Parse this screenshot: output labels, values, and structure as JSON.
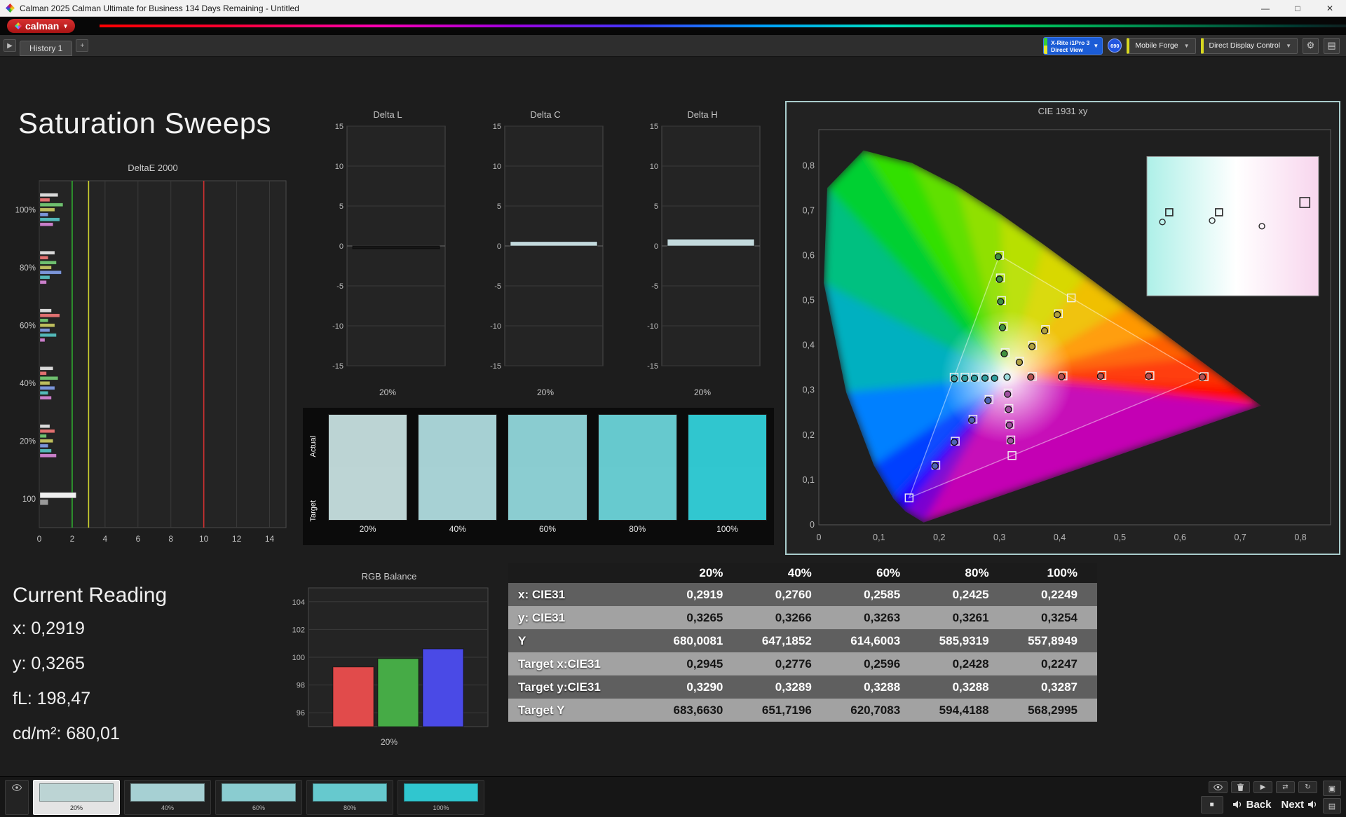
{
  "titlebar": {
    "title": "Calman 2025 Calman Ultimate for Business 134 Days Remaining  - Untitled",
    "minimize": "—",
    "maximize": "□",
    "close": "✕"
  },
  "logobar": {
    "brand": "calman",
    "dropdown": "▾"
  },
  "toolbar": {
    "expand": "▶",
    "history_tab": "History 1",
    "add_tab": "+",
    "meter_button": {
      "line1": "X-Rite i1Pro 3",
      "line2": "Direct View",
      "dropdown": "▼"
    },
    "badge": "690",
    "source_button": {
      "label": "Mobile Forge",
      "dropdown": "▼"
    },
    "control_button": {
      "label": "Direct Display Control",
      "dropdown": "▼"
    },
    "gear": "⚙",
    "panel": "▤"
  },
  "page_title": "Saturation Sweeps",
  "current_reading": {
    "title": "Current Reading",
    "lines": [
      "x: 0,2919",
      "y: 0,3265",
      "fL: 198,47",
      "cd/m²: 680,01"
    ]
  },
  "charts": {
    "deltae": {
      "type": "bar",
      "title": "DeltaE 2000",
      "x_ticks": [
        0,
        2,
        4,
        6,
        8,
        10,
        12,
        14
      ],
      "xmax": 15,
      "ref_lines": [
        {
          "value": 2,
          "color": "#2fae2f"
        },
        {
          "value": 3,
          "color": "#cdd230"
        },
        {
          "value": 10,
          "color": "#d03030"
        }
      ],
      "bar_palette": [
        "#d9d9d9",
        "#e07070",
        "#6fbf6f",
        "#bdbd5e",
        "#7b95d8",
        "#54b8b8",
        "#c97fc9"
      ],
      "groups": [
        {
          "label": "100%",
          "bars": [
            1.1,
            0.6,
            1.4,
            0.9,
            0.5,
            1.2,
            0.8
          ]
        },
        {
          "label": "80%",
          "bars": [
            0.9,
            0.5,
            1.0,
            0.7,
            1.3,
            0.6,
            0.4
          ]
        },
        {
          "label": "60%",
          "bars": [
            0.7,
            1.2,
            0.5,
            0.9,
            0.6,
            1.0,
            0.3
          ]
        },
        {
          "label": "40%",
          "bars": [
            0.8,
            0.4,
            1.1,
            0.6,
            0.9,
            0.5,
            0.7
          ]
        },
        {
          "label": "20%",
          "bars": [
            0.6,
            0.9,
            0.4,
            0.8,
            0.5,
            0.7,
            1.0
          ]
        },
        {
          "label": "100",
          "bars": [
            2.2,
            0.5
          ],
          "palette": [
            "#efefef",
            "#9a9a9a"
          ]
        }
      ]
    },
    "delta_l": {
      "type": "bar",
      "title": "Delta L",
      "xlabel": "20%",
      "value": -0.35,
      "color": "#161616",
      "ymin": -15,
      "ymax": 15
    },
    "delta_c": {
      "type": "bar",
      "title": "Delta C",
      "xlabel": "20%",
      "value": 0.55,
      "color": "#c3dadd",
      "ymin": -15,
      "ymax": 15
    },
    "delta_h": {
      "type": "bar",
      "title": "Delta H",
      "xlabel": "20%",
      "value": 0.85,
      "color": "#c3dadd",
      "ymin": -15,
      "ymax": 15
    },
    "rgb": {
      "type": "bar",
      "title": "RGB Balance",
      "xlabel": "20%",
      "ymin": 95,
      "ymax": 105,
      "y_ticks": [
        96,
        98,
        100,
        102,
        104
      ],
      "bars": [
        {
          "name": "red",
          "value": 99.3,
          "color": "#e14b4b"
        },
        {
          "name": "green",
          "value": 99.9,
          "color": "#46ab46"
        },
        {
          "name": "blue",
          "value": 100.6,
          "color": "#4a4ae6"
        }
      ]
    },
    "cie": {
      "type": "scatter",
      "title": "CIE 1931 xy",
      "x_ticks": [
        "0",
        "0,1",
        "0,2",
        "0,3",
        "0,4",
        "0,5",
        "0,6",
        "0,7",
        "0,8"
      ],
      "y_ticks": [
        "0",
        "0,1",
        "0,2",
        "0,3",
        "0,4",
        "0,5",
        "0,6",
        "0,7",
        "0,8"
      ],
      "white_point": [
        0.3127,
        0.329
      ],
      "gamut_triangle": [
        [
          0.64,
          0.33
        ],
        [
          0.3,
          0.6
        ],
        [
          0.15,
          0.06
        ]
      ],
      "sweeps": [
        {
          "name": "cyan",
          "color": "#2f9f9f",
          "targets": [
            [
              0.2945,
              0.329
            ],
            [
              0.2776,
              0.3289
            ],
            [
              0.2596,
              0.3288
            ],
            [
              0.2428,
              0.3288
            ],
            [
              0.2247,
              0.3287
            ]
          ],
          "measured": [
            [
              0.2919,
              0.3265
            ],
            [
              0.276,
              0.3266
            ],
            [
              0.2585,
              0.3263
            ],
            [
              0.2425,
              0.3261
            ],
            [
              0.2249,
              0.3254
            ]
          ]
        },
        {
          "name": "red",
          "color": "#b45050",
          "targets": [
            [
              0.3547,
              0.3303
            ],
            [
              0.4056,
              0.3316
            ],
            [
              0.4703,
              0.3326
            ],
            [
              0.55,
              0.3322
            ],
            [
              0.64,
              0.33
            ]
          ],
          "measured": [
            [
              0.352,
              0.329
            ],
            [
              0.403,
              0.33
            ],
            [
              0.468,
              0.331
            ],
            [
              0.548,
              0.331
            ],
            [
              0.637,
              0.329
            ]
          ]
        },
        {
          "name": "green",
          "color": "#3f8f3f",
          "targets": [
            [
              0.3096,
              0.3837
            ],
            [
              0.3063,
              0.4419
            ],
            [
              0.3036,
              0.4994
            ],
            [
              0.3016,
              0.5498
            ],
            [
              0.3,
              0.6
            ]
          ],
          "measured": [
            [
              0.308,
              0.381
            ],
            [
              0.305,
              0.439
            ],
            [
              0.302,
              0.497
            ],
            [
              0.3,
              0.547
            ],
            [
              0.298,
              0.597
            ]
          ]
        },
        {
          "name": "blue",
          "color": "#4f64b4",
          "targets": [
            [
              0.2827,
              0.2793
            ],
            [
              0.2561,
              0.2352
            ],
            [
              0.2266,
              0.1862
            ],
            [
              0.1944,
              0.1327
            ],
            [
              0.15,
              0.06
            ]
          ],
          "measured": [
            [
              0.281,
              0.277
            ],
            [
              0.254,
              0.233
            ],
            [
              0.225,
              0.184
            ],
            [
              0.193,
              0.131
            ],
            null
          ]
        },
        {
          "name": "magenta",
          "color": "#a050a0",
          "targets": [
            [
              0.3143,
              0.2936
            ],
            [
              0.3158,
              0.259
            ],
            [
              0.3174,
              0.2238
            ],
            [
              0.319,
              0.189
            ],
            [
              0.3209,
              0.1542
            ]
          ],
          "measured": [
            [
              0.3135,
              0.291
            ],
            [
              0.315,
              0.257
            ],
            [
              0.3165,
              0.222
            ],
            [
              0.3185,
              0.187
            ],
            null
          ]
        },
        {
          "name": "yellow",
          "color": "#b0a040",
          "targets": [
            [
              0.3338,
              0.3642
            ],
            [
              0.3551,
              0.3994
            ],
            [
              0.3766,
              0.4349
            ],
            [
              0.398,
              0.4701
            ],
            [
              0.4193,
              0.5053
            ]
          ],
          "measured": [
            [
              0.333,
              0.362
            ],
            [
              0.354,
              0.397
            ],
            [
              0.375,
              0.432
            ],
            [
              0.396,
              0.468
            ],
            null
          ]
        }
      ],
      "inset": {
        "squares": [
          [
            0.13,
            0.4
          ],
          [
            0.42,
            0.4
          ],
          [
            0.92,
            0.33
          ]
        ],
        "circles": [
          [
            0.09,
            0.47
          ],
          [
            0.38,
            0.46
          ],
          [
            0.67,
            0.5
          ]
        ]
      }
    }
  },
  "swatch_strip": {
    "row_labels": [
      "Actual",
      "Target"
    ],
    "items": [
      {
        "label": "20%",
        "actual": "#bcd4d4",
        "target": "#bdd5d5"
      },
      {
        "label": "40%",
        "actual": "#a6d0d3",
        "target": "#a7d1d4"
      },
      {
        "label": "60%",
        "actual": "#8accd0",
        "target": "#8bcdd1"
      },
      {
        "label": "80%",
        "actual": "#66c9ce",
        "target": "#67cacf"
      },
      {
        "label": "100%",
        "actual": "#30c6cf",
        "target": "#31c7d0"
      }
    ]
  },
  "table": {
    "columns": [
      "",
      "20%",
      "40%",
      "60%",
      "80%",
      "100%"
    ],
    "rows": [
      {
        "label": "x: CIE31",
        "values": [
          "0,2919",
          "0,2760",
          "0,2585",
          "0,2425",
          "0,2249"
        ]
      },
      {
        "label": "y: CIE31",
        "values": [
          "0,3265",
          "0,3266",
          "0,3263",
          "0,3261",
          "0,3254"
        ]
      },
      {
        "label": "Y",
        "values": [
          "680,0081",
          "647,1852",
          "614,6003",
          "585,9319",
          "557,8949"
        ]
      },
      {
        "label": "Target x:CIE31",
        "values": [
          "0,2945",
          "0,2776",
          "0,2596",
          "0,2428",
          "0,2247"
        ]
      },
      {
        "label": "Target y:CIE31",
        "values": [
          "0,3290",
          "0,3289",
          "0,3288",
          "0,3288",
          "0,3287"
        ]
      },
      {
        "label": "Target Y",
        "values": [
          "683,6630",
          "651,7196",
          "620,7083",
          "594,4188",
          "568,2995"
        ]
      }
    ]
  },
  "bottombar": {
    "swatches": [
      {
        "label": "20%",
        "color": "#bcd4d4",
        "selected": true
      },
      {
        "label": "40%",
        "color": "#a6d0d3",
        "selected": false
      },
      {
        "label": "60%",
        "color": "#8accd0",
        "selected": false
      },
      {
        "label": "80%",
        "color": "#66c9ce",
        "selected": false
      },
      {
        "label": "100%",
        "color": "#30c6cf",
        "selected": false
      }
    ],
    "back": "Back",
    "next": "Next",
    "icons": {
      "play": "▶",
      "stop": "■",
      "refresh": "↻",
      "shuffle": "⇄",
      "read": "◉"
    }
  }
}
